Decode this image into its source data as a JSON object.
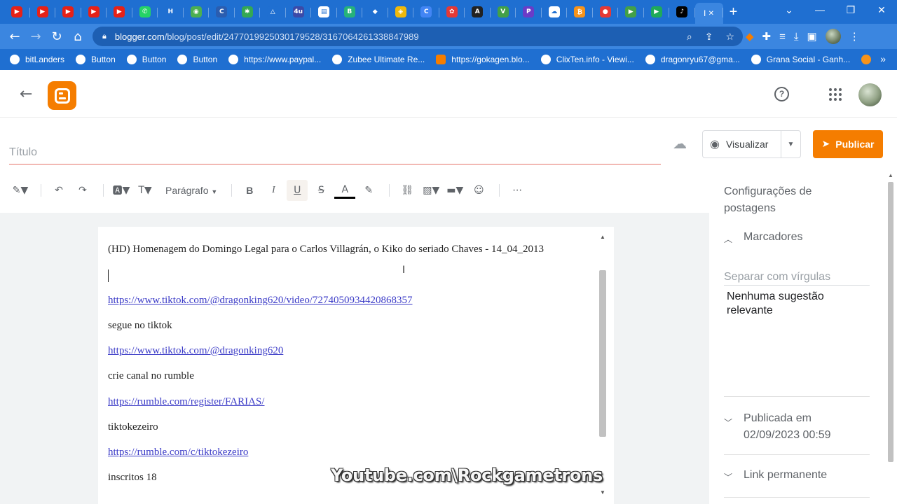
{
  "browser": {
    "tabs": [
      {
        "icon": "youtube-icon",
        "color": "#e62117",
        "glyph": "▶"
      },
      {
        "icon": "youtube-icon",
        "color": "#e62117",
        "glyph": "▶"
      },
      {
        "icon": "youtube-icon",
        "color": "#e62117",
        "glyph": "▶"
      },
      {
        "icon": "youtube-icon",
        "color": "#e62117",
        "glyph": "▶"
      },
      {
        "icon": "youtube-icon",
        "color": "#e62117",
        "glyph": "▶"
      },
      {
        "icon": "whatsapp-icon",
        "color": "#25d366",
        "glyph": "✆"
      },
      {
        "icon": "hive-icon",
        "color": "#1f6fd1",
        "glyph": "H"
      },
      {
        "icon": "globe-icon",
        "color": "#4caf50",
        "glyph": "◉"
      },
      {
        "icon": "coin-icon",
        "color": "#2a5db0",
        "glyph": "C"
      },
      {
        "icon": "asterisk-icon",
        "color": "#34a853",
        "glyph": "✱"
      },
      {
        "icon": "triangle-icon",
        "color": "#1f6fd1",
        "glyph": "△"
      },
      {
        "icon": "4u-icon",
        "color": "#3b4aa8",
        "glyph": "4u"
      },
      {
        "icon": "doc-icon",
        "color": "#ffffff",
        "glyph": "▤"
      },
      {
        "icon": "b-coin-icon",
        "color": "#26b27a",
        "glyph": "B"
      },
      {
        "icon": "ethereum-icon",
        "color": "#1f6fd1",
        "glyph": "◆"
      },
      {
        "icon": "binance-icon",
        "color": "#f0b90b",
        "glyph": "◈"
      },
      {
        "icon": "c-circle-icon",
        "color": "#4285f4",
        "glyph": "C"
      },
      {
        "icon": "flower-icon",
        "color": "#e53935",
        "glyph": "✿"
      },
      {
        "icon": "a-icon",
        "color": "#222222",
        "glyph": "A"
      },
      {
        "icon": "v-icon",
        "color": "#43a047",
        "glyph": "V"
      },
      {
        "icon": "p-icon",
        "color": "#6a3cc7",
        "glyph": "P"
      },
      {
        "icon": "cloud-icon",
        "color": "#ffffff",
        "glyph": "☁"
      },
      {
        "icon": "bitcoin-icon",
        "color": "#f7931a",
        "glyph": "₿"
      },
      {
        "icon": "drop-icon",
        "color": "#e53935",
        "glyph": "●"
      },
      {
        "icon": "play-icon",
        "color": "#43a047",
        "glyph": "▶"
      },
      {
        "icon": "play-icon",
        "color": "#1faa59",
        "glyph": "▶"
      },
      {
        "icon": "tiktok-icon",
        "color": "#000000",
        "glyph": "♪"
      }
    ],
    "active_tab": {
      "label": "I",
      "close": "✕"
    },
    "new_tab": "+",
    "window_controls": {
      "menu": "⌄",
      "minimize": "—",
      "restore": "❐",
      "close": "✕"
    },
    "url_host": "blogger.com",
    "url_path": "/blog/post/edit/2477019925030179528/3167064261338847989",
    "bookmarks": [
      {
        "label": "bitLanders",
        "icon": "bookmark-icon"
      },
      {
        "label": "Button",
        "icon": "bookmark-icon"
      },
      {
        "label": "Button",
        "icon": "bookmark-icon"
      },
      {
        "label": "Button",
        "icon": "bookmark-icon"
      },
      {
        "label": "https://www.paypal...",
        "icon": "paypal-icon"
      },
      {
        "label": "Zubee Ultimate Re...",
        "icon": "bookmark-icon"
      },
      {
        "label": "https://gokagen.blo...",
        "icon": "blogger-icon"
      },
      {
        "label": "ClixTen.info - Viewi...",
        "icon": "bookmark-icon"
      },
      {
        "label": "dragonryu67@gma...",
        "icon": "google-icon"
      },
      {
        "label": "Grana Social - Ganh...",
        "icon": "bookmark-icon"
      },
      {
        "label": "",
        "icon": "bitcoin-icon"
      }
    ],
    "bookmarks_more": "»"
  },
  "editor": {
    "title_placeholder": "Título",
    "preview_label": "Visualizar",
    "publish_label": "Publicar",
    "paragraph_label": "Parágrafo",
    "lines": [
      {
        "text": "(HD) Homenagem do Domingo Legal para o Carlos Villagrán, o Kiko do seriado Chaves - 14_04_2013",
        "link": false
      },
      {
        "text": "",
        "link": false
      },
      {
        "text": "https://www.tiktok.com/@dragonking620/video/7274050934420868357",
        "link": true
      },
      {
        "text": "segue no tiktok",
        "link": false
      },
      {
        "text": "https://www.tiktok.com/@dragonking620",
        "link": true
      },
      {
        "text": "crie canal no rumble",
        "link": false
      },
      {
        "text": "https://rumble.com/register/FARIAS/",
        "link": true
      },
      {
        "text": "tiktokezeiro",
        "link": false
      },
      {
        "text": "https://rumble.com/c/tiktokezeiro",
        "link": true
      },
      {
        "text": "inscritos 18",
        "link": false
      }
    ]
  },
  "side": {
    "title": "Configurações de postagens",
    "labels_heading": "Marcadores",
    "labels_placeholder": "Separar com vírgulas",
    "no_suggestions": "Nenhuma sugestão relevante",
    "published_heading": "Publicada em",
    "published_date": "02/09/2023 00:59",
    "permalink_heading": "Link permanente"
  },
  "watermark": "Youtube.com\\Rockgametrons",
  "colors": {
    "accent": "#f57d00",
    "browser": "#1f6fd1",
    "link": "#3b3bc7"
  }
}
